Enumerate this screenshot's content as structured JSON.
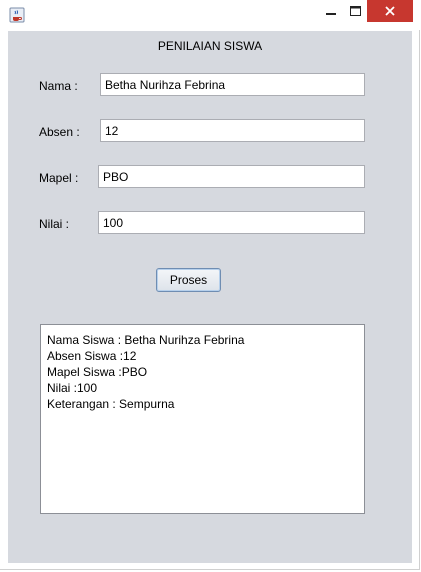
{
  "window": {
    "app_icon": "java-coffee-icon",
    "controls": {
      "minimize": "minimize-icon",
      "maximize": "maximize-icon",
      "close": "close-icon"
    },
    "close_color": "#c7372f"
  },
  "form": {
    "heading": "PENILAIAN SISWA",
    "nama_label": "Nama :",
    "nama_value": "Betha Nurihza Febrina",
    "absen_label": "Absen :",
    "absen_value": "12",
    "mapel_label": "Mapel :",
    "mapel_value": "PBO",
    "nilai_label": "Nilai :",
    "nilai_value": "100",
    "button_label": "Proses",
    "background": "#d6d9df"
  },
  "output": {
    "lines": [
      "Nama Siswa : Betha Nurihza Febrina",
      "Absen Siswa :12",
      "Mapel Siswa :PBO",
      "Nilai :100",
      "Keterangan : Sempurna"
    ]
  }
}
